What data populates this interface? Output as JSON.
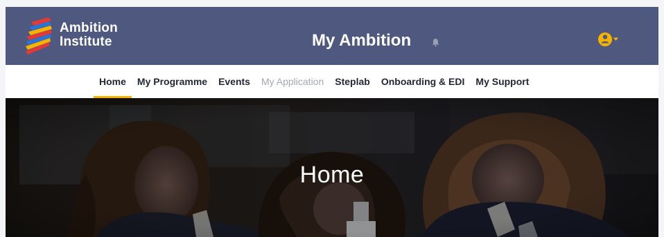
{
  "branding": {
    "name_line1": "Ambition",
    "name_line2": "Institute",
    "logo_icon": "ambition-stripes-logo",
    "colors": {
      "header": "#4f587e",
      "accent": "#f6b400",
      "red": "#e53935",
      "blue": "#2a74d6",
      "yellow": "#f6b400"
    }
  },
  "header": {
    "title": "My Ambition",
    "notification_icon": "bell-icon",
    "account_icon": "user-icon",
    "account_dropdown_icon": "caret-down-icon"
  },
  "nav": {
    "items": [
      {
        "label": "Home",
        "active": true,
        "disabled": false
      },
      {
        "label": "My Programme",
        "active": false,
        "disabled": false
      },
      {
        "label": "Events",
        "active": false,
        "disabled": false
      },
      {
        "label": "My Application",
        "active": false,
        "disabled": true
      },
      {
        "label": "Steplab",
        "active": false,
        "disabled": false
      },
      {
        "label": "Onboarding & EDI",
        "active": false,
        "disabled": false
      },
      {
        "label": "My Support",
        "active": false,
        "disabled": false
      }
    ]
  },
  "hero": {
    "title": "Home"
  }
}
